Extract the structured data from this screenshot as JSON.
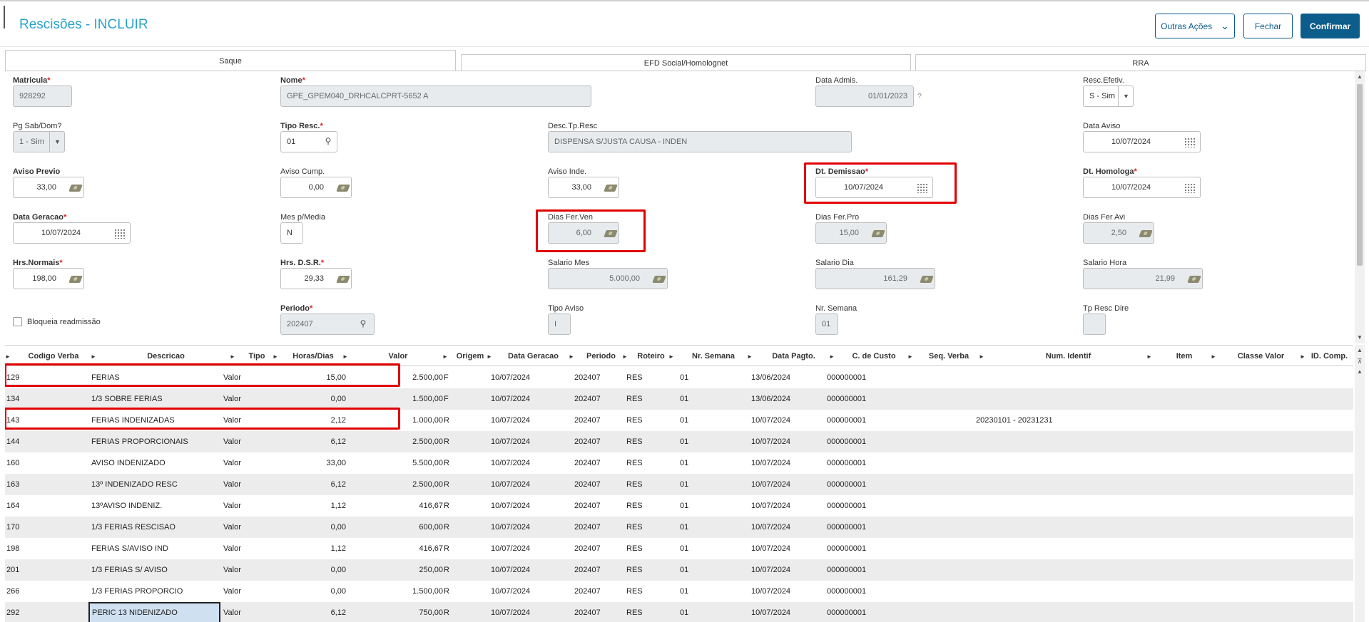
{
  "header": {
    "title": "Rescisões - INCLUIR",
    "actions_label": "Outras Ações",
    "close_label": "Fechar",
    "confirm_label": "Confirmar"
  },
  "tabs": [
    {
      "label": "Saque",
      "active": true
    },
    {
      "label": "EFD Social/Homolognet",
      "active": false
    },
    {
      "label": "RRA",
      "active": false
    }
  ],
  "form": {
    "matricula": {
      "label": "Matricula",
      "value": "928292"
    },
    "nome": {
      "label": "Nome",
      "value": "GPE_GPEM040_DRHCALCPRT-5652 A"
    },
    "data_admis": {
      "label": "Data Admis.",
      "value": "01/01/2023"
    },
    "resc_efetiv": {
      "label": "Resc.Efetiv.",
      "value": "S - Sim"
    },
    "pg_sab_dom": {
      "label": "Pg Sab/Dom?",
      "value": "1 - Sim"
    },
    "tipo_resc": {
      "label": "Tipo Resc.",
      "value": "01"
    },
    "desc_tp_resc": {
      "label": "Desc.Tp.Resc",
      "value": "DISPENSA S/JUSTA CAUSA - INDEN"
    },
    "data_aviso": {
      "label": "Data Aviso",
      "value": "10/07/2024"
    },
    "aviso_previo": {
      "label": "Aviso Previo",
      "value": "33,00"
    },
    "aviso_cump": {
      "label": "Aviso Cump.",
      "value": "0,00"
    },
    "aviso_inde": {
      "label": "Aviso Inde.",
      "value": "33,00"
    },
    "dt_demissao": {
      "label": "Dt. Demissao",
      "value": "10/07/2024"
    },
    "dt_homologa": {
      "label": "Dt. Homologa",
      "value": "10/07/2024"
    },
    "data_geracao": {
      "label": "Data Geracao",
      "value": "10/07/2024"
    },
    "mes_media": {
      "label": "Mes p/Media",
      "value": "N"
    },
    "dias_fer_ven": {
      "label": "Dias Fer.Ven",
      "value": "6,00"
    },
    "dias_fer_pro": {
      "label": "Dias Fer.Pro",
      "value": "15,00"
    },
    "dias_fer_avi": {
      "label": "Dias Fer Avi",
      "value": "2,50"
    },
    "hrs_normais": {
      "label": "Hrs.Normais",
      "value": "198,00"
    },
    "hrs_dsr": {
      "label": "Hrs. D.S.R.",
      "value": "29,33"
    },
    "salario_mes": {
      "label": "Salario Mes",
      "value": "5.000,00"
    },
    "salario_dia": {
      "label": "Salario Dia",
      "value": "161,29"
    },
    "salario_hora": {
      "label": "Salario Hora",
      "value": "21,99"
    },
    "bloqueia": {
      "label": "Bloqueia readmissão"
    },
    "periodo": {
      "label": "Periodo",
      "value": "202407"
    },
    "tipo_aviso": {
      "label": "Tipo Aviso",
      "value": "I"
    },
    "nr_semana": {
      "label": "Nr. Semana",
      "value": "01"
    },
    "tp_resc_dire": {
      "label": "Tp Resc Dire",
      "value": ""
    }
  },
  "grid": {
    "columns": [
      "Codigo Verba",
      "Descricao",
      "Tipo",
      "Horas/Dias",
      "Valor",
      "Origem",
      "Data Geracao",
      "Periodo",
      "Roteiro",
      "Nr. Semana",
      "Data Pagto.",
      "C. de Custo",
      "Seq. Verba",
      "Num. Identif",
      "Item",
      "Classe Valor",
      "ID. Comp."
    ],
    "rows": [
      [
        "129",
        "FERIAS",
        "Valor",
        "15,00",
        "2.500,00",
        "F",
        "10/07/2024",
        "202407",
        "RES",
        "01",
        "13/06/2024",
        "000000001",
        "",
        ""
      ],
      [
        "134",
        "1/3 SOBRE FERIAS",
        "Valor",
        "0,00",
        "1.500,00",
        "F",
        "10/07/2024",
        "202407",
        "RES",
        "01",
        "13/06/2024",
        "000000001",
        "",
        ""
      ],
      [
        "143",
        "FERIAS INDENIZADAS",
        "Valor",
        "2,12",
        "1.000,00",
        "R",
        "10/07/2024",
        "202407",
        "RES",
        "01",
        "10/07/2024",
        "000000001",
        "",
        "20230101 - 20231231"
      ],
      [
        "144",
        "FERIAS PROPORCIONAIS",
        "Valor",
        "6,12",
        "2.500,00",
        "R",
        "10/07/2024",
        "202407",
        "RES",
        "01",
        "10/07/2024",
        "000000001",
        "",
        ""
      ],
      [
        "160",
        "AVISO INDENIZADO",
        "Valor",
        "33,00",
        "5.500,00",
        "R",
        "10/07/2024",
        "202407",
        "RES",
        "01",
        "10/07/2024",
        "000000001",
        "",
        ""
      ],
      [
        "163",
        "13º INDENIZADO RESC",
        "Valor",
        "6,12",
        "2.500,00",
        "R",
        "10/07/2024",
        "202407",
        "RES",
        "01",
        "10/07/2024",
        "000000001",
        "",
        ""
      ],
      [
        "164",
        "13ºAVISO INDENIZ.",
        "Valor",
        "1,12",
        "416,67",
        "R",
        "10/07/2024",
        "202407",
        "RES",
        "01",
        "10/07/2024",
        "000000001",
        "",
        ""
      ],
      [
        "170",
        "1/3 FERIAS RESCISAO",
        "Valor",
        "0,00",
        "600,00",
        "R",
        "10/07/2024",
        "202407",
        "RES",
        "01",
        "10/07/2024",
        "000000001",
        "",
        ""
      ],
      [
        "198",
        "FERIAS S/AVISO IND",
        "Valor",
        "1,12",
        "416,67",
        "R",
        "10/07/2024",
        "202407",
        "RES",
        "01",
        "10/07/2024",
        "000000001",
        "",
        ""
      ],
      [
        "201",
        "1/3 FERIAS S/ AVISO",
        "Valor",
        "0,00",
        "250,00",
        "R",
        "10/07/2024",
        "202407",
        "RES",
        "01",
        "10/07/2024",
        "000000001",
        "",
        ""
      ],
      [
        "266",
        "1/3 FERIAS PROPORCIO",
        "Valor",
        "0,00",
        "1.500,00",
        "R",
        "10/07/2024",
        "202407",
        "RES",
        "01",
        "10/07/2024",
        "000000001",
        "",
        ""
      ],
      [
        "292",
        "PERIC 13 NIDENIZADO",
        "Valor",
        "6,12",
        "750,00",
        "R",
        "10/07/2024",
        "202407",
        "RES",
        "01",
        "10/07/2024",
        "000000001",
        "",
        ""
      ]
    ]
  }
}
